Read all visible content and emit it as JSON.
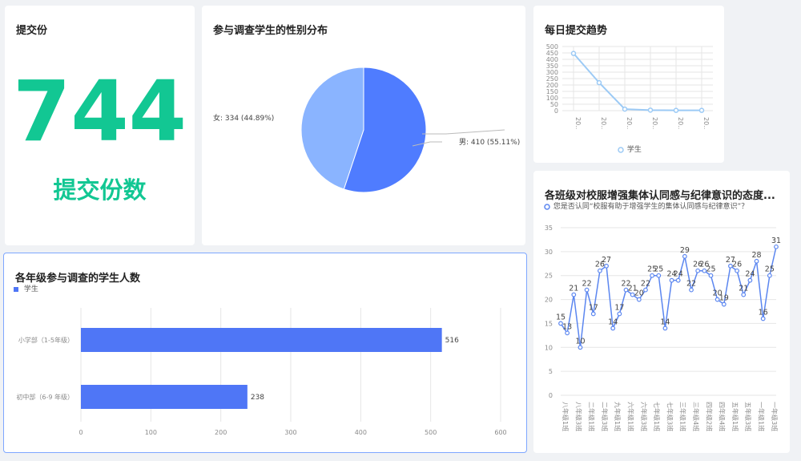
{
  "count_card": {
    "title": "提交份",
    "value": "744",
    "label": "提交份数"
  },
  "gender_card": {
    "title": "参与调查学生的性别分布",
    "chart_data": {
      "type": "pie",
      "title": "参与调查学生的性别分布",
      "slices": [
        {
          "name": "男",
          "value": 410,
          "percent": "55.11%",
          "color": "#4f7cff"
        },
        {
          "name": "女",
          "value": 334,
          "percent": "44.89%",
          "color": "#8ab4ff"
        }
      ]
    },
    "label_male": "男: 410 (55.11%)",
    "label_female": "女: 334 (44.89%)"
  },
  "trend_card": {
    "title": "每日提交趋势",
    "legend": "学生",
    "chart_data": {
      "type": "line",
      "title": "每日提交趋势",
      "categories": [
        "20..",
        "20..",
        "20..",
        "20..",
        "20..",
        "20.."
      ],
      "series": [
        {
          "name": "学生",
          "values": [
            446,
            218,
            12,
            4,
            2,
            2
          ],
          "color": "#9ccaf5"
        }
      ],
      "ylim": [
        0,
        500
      ],
      "yticks": [
        0,
        50,
        100,
        150,
        200,
        250,
        300,
        350,
        400,
        450,
        500
      ],
      "grid": true,
      "legend_position": "bottom"
    }
  },
  "class_card": {
    "title": "各班级对校服增强集体认同感与纪律意识的态度...",
    "legend": "您是否认同“校服有助于增强学生的集体认同感与纪律意识”？",
    "chart_data": {
      "type": "line",
      "title": "各班级对校服增强集体认同感与纪律意识的态度...",
      "categories": [
        "八年级1班",
        "",
        "八年级3班",
        "",
        "二年级1班",
        "",
        "二年级3班",
        "",
        "九年级1班",
        "",
        "六年级1班",
        "",
        "六年级3班",
        "",
        "七年级1班",
        "",
        "七年级3班",
        "",
        "三年级1班",
        "",
        "三年级4班",
        "",
        "四年级2班",
        "",
        "四年级4班",
        "",
        "五年级1班",
        "",
        "五年级3班",
        "",
        "一年级1班",
        "",
        "一年级3班"
      ],
      "series": [
        {
          "name": "您是否认同“校服有助于增强学生的集体认同感与纪律意识”？",
          "values": [
            15,
            13,
            21,
            10,
            22,
            17,
            26,
            27,
            14,
            17,
            22,
            21,
            20,
            22,
            25,
            25,
            14,
            24,
            24,
            29,
            22,
            26,
            26,
            25,
            20,
            19,
            27,
            26,
            21,
            24,
            28,
            16,
            25,
            31
          ],
          "color": "#5b86f0"
        }
      ],
      "ylim": [
        0,
        35
      ],
      "yticks": [
        0,
        5,
        10,
        15,
        20,
        25,
        30,
        35
      ],
      "grid": true,
      "legend_position": "top-left"
    }
  },
  "grade_card": {
    "title": "各年级参与调查的学生人数",
    "legend": "学生",
    "chart_data": {
      "type": "bar",
      "orientation": "horizontal",
      "title": "各年级参与调查的学生人数",
      "categories": [
        "小学部（1-5年级）",
        "初中部（6-9 年级）"
      ],
      "series": [
        {
          "name": "学生",
          "values": [
            516,
            238
          ],
          "color": "#4f76f6"
        }
      ],
      "xlim": [
        0,
        600
      ],
      "xticks": [
        0,
        100,
        200,
        300,
        400,
        500,
        600
      ],
      "grid": true,
      "legend_position": "top-left"
    }
  }
}
